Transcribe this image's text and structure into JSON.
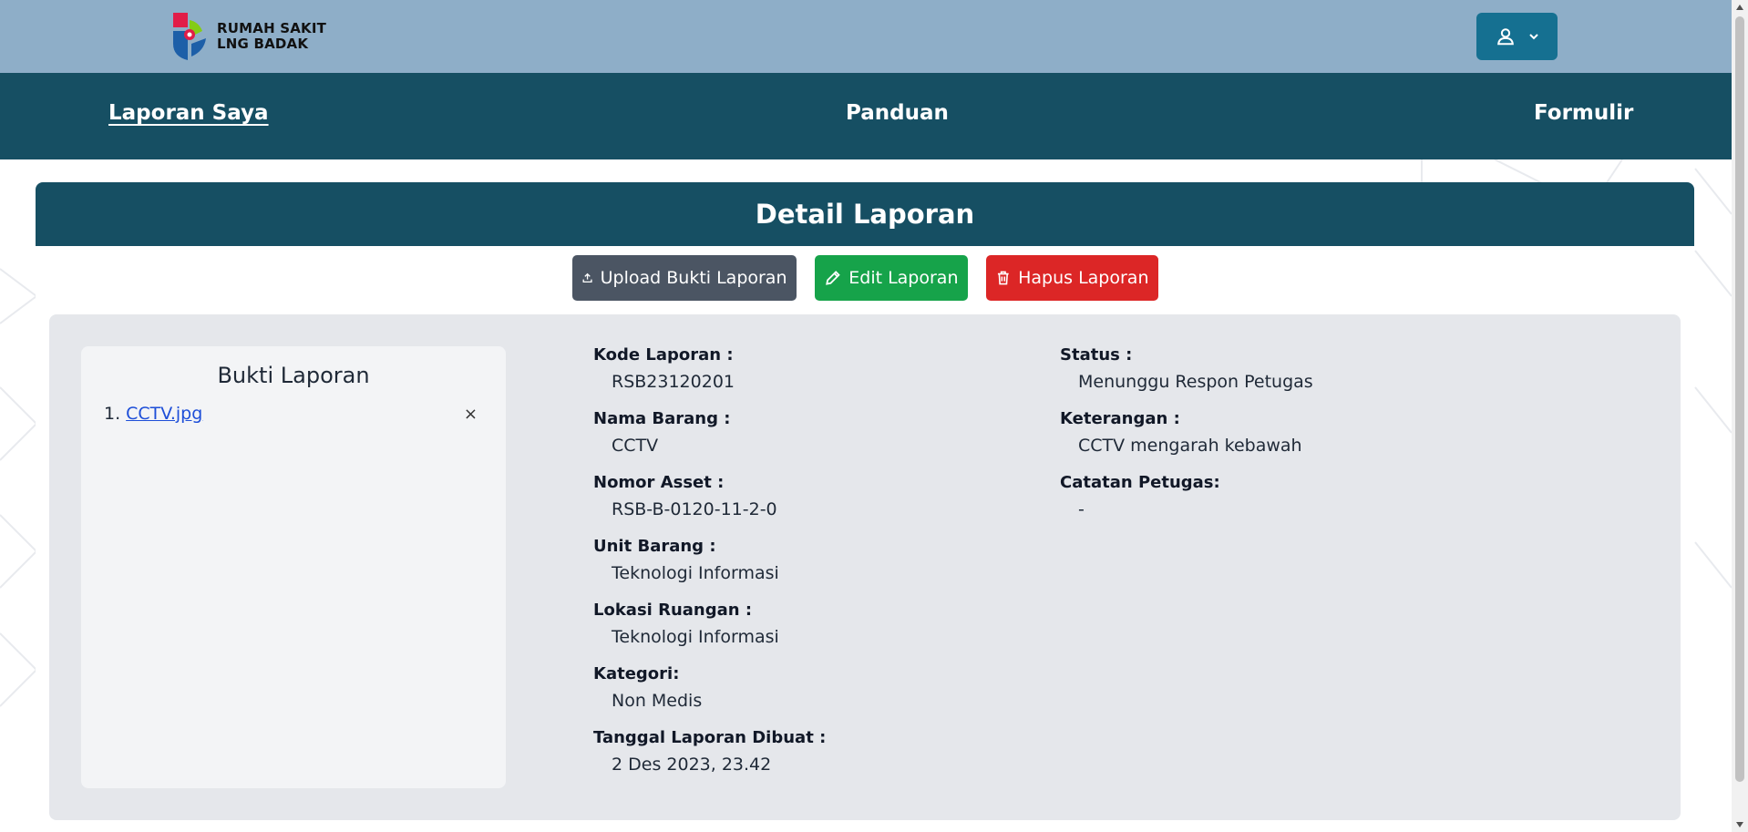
{
  "header": {
    "logo_line1": "RUMAH SAKIT",
    "logo_line2": "LNG BADAK",
    "user_icon": "user-icon",
    "dropdown_icon": "chevron-down-icon"
  },
  "nav": {
    "items": [
      {
        "label": "Laporan Saya",
        "active": true
      },
      {
        "label": "Panduan",
        "active": false
      },
      {
        "label": "Formulir",
        "active": false
      }
    ]
  },
  "detail": {
    "title": "Detail Laporan",
    "actions": {
      "upload": "Upload Bukti Laporan",
      "edit": "Edit Laporan",
      "delete": "Hapus Laporan"
    },
    "bukti": {
      "title": "Bukti Laporan",
      "files": [
        {
          "number": "1.",
          "name": "CCTV.jpg"
        }
      ],
      "remove_symbol": "×"
    },
    "fields_left": [
      {
        "label": "Kode Laporan :",
        "value": "RSB23120201"
      },
      {
        "label": "Nama Barang :",
        "value": "CCTV"
      },
      {
        "label": "Nomor Asset :",
        "value": "RSB-B-0120-11-2-0"
      },
      {
        "label": "Unit Barang :",
        "value": "Teknologi Informasi"
      },
      {
        "label": "Lokasi Ruangan :",
        "value": "Teknologi Informasi"
      },
      {
        "label": "Kategori:",
        "value": "Non Medis"
      },
      {
        "label": "Tanggal Laporan Dibuat :",
        "value": "2 Des 2023, 23.42"
      }
    ],
    "fields_right": [
      {
        "label": "Status :",
        "value": "Menunggu Respon Petugas"
      },
      {
        "label": "Keterangan :",
        "value": "CCTV mengarah kebawah"
      },
      {
        "label": "Catatan Petugas:",
        "value": "-"
      }
    ]
  },
  "colors": {
    "topbar": "#8eaec8",
    "navbar": "#164f63",
    "user_button": "#157091",
    "btn_upload": "#4b5563",
    "btn_edit": "#16a34a",
    "btn_delete": "#dc2626"
  }
}
